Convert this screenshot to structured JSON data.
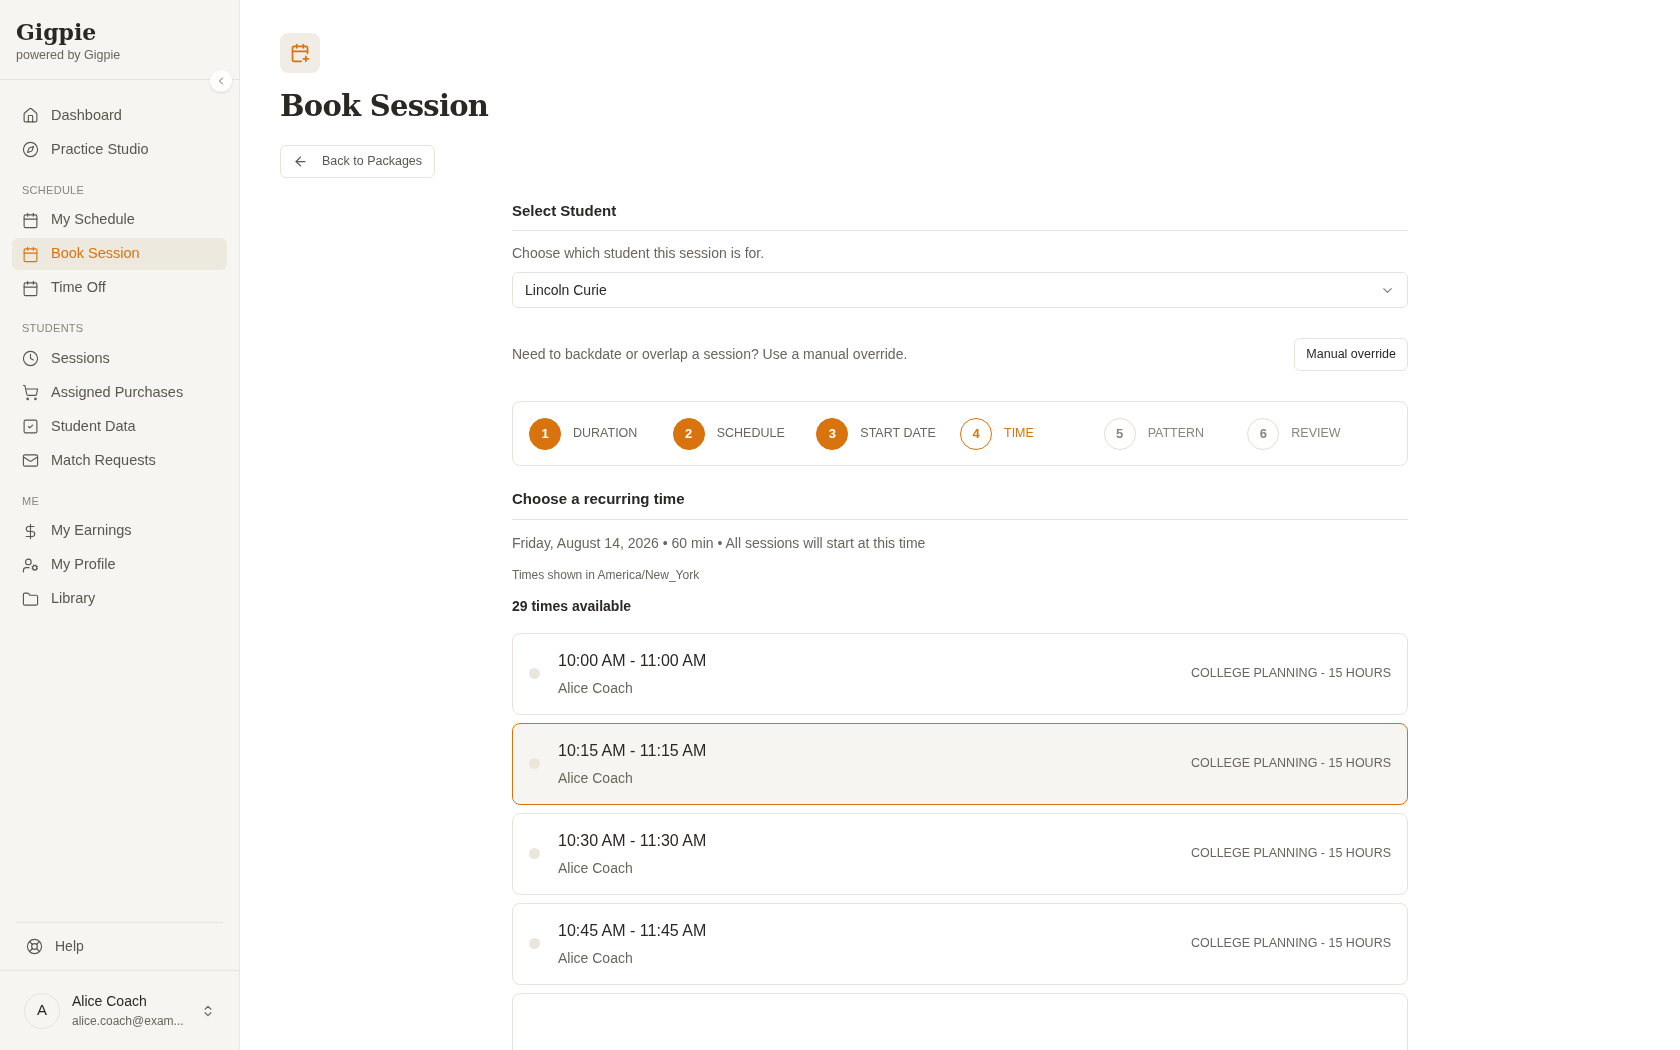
{
  "brand": {
    "name": "Gigpie",
    "tagline": "powered by Gigpie"
  },
  "sidebar": {
    "sections": [
      {
        "items": [
          {
            "label": "Dashboard",
            "selected": false
          },
          {
            "label": "Practice Studio",
            "selected": false
          }
        ]
      },
      {
        "heading": "SCHEDULE",
        "items": [
          {
            "label": "My Schedule",
            "selected": false
          },
          {
            "label": "Book Session",
            "selected": true
          },
          {
            "label": "Time Off",
            "selected": false
          }
        ]
      },
      {
        "heading": "STUDENTS",
        "items": [
          {
            "label": "Sessions",
            "selected": false
          },
          {
            "label": "Assigned Purchases",
            "selected": false
          },
          {
            "label": "Student Data",
            "selected": false
          },
          {
            "label": "Match Requests",
            "selected": false
          }
        ]
      },
      {
        "heading": "ME",
        "items": [
          {
            "label": "My Earnings",
            "selected": false
          },
          {
            "label": "My Profile",
            "selected": false
          },
          {
            "label": "Library",
            "selected": false
          }
        ]
      }
    ],
    "help": "Help",
    "user": {
      "initial": "A",
      "name": "Alice Coach",
      "email": "alice.coach@exam..."
    }
  },
  "page": {
    "title": "Book Session",
    "back_button": "Back to Packages"
  },
  "student": {
    "heading": "Select Student",
    "hint": "Choose which student this session is for.",
    "value": "Lincoln Curie",
    "override_text": "Need to backdate or overlap a session? Use a manual override.",
    "override_button": "Manual override"
  },
  "steps": [
    {
      "number": "1",
      "label": "DURATION",
      "completed": true,
      "selected": false
    },
    {
      "number": "2",
      "label": "SCHEDULE",
      "completed": true,
      "selected": false
    },
    {
      "number": "3",
      "label": "START DATE",
      "completed": true,
      "selected": false
    },
    {
      "number": "4",
      "label": "TIME",
      "completed": false,
      "selected": true
    },
    {
      "number": "5",
      "label": "PATTERN",
      "completed": false,
      "selected": false
    },
    {
      "number": "6",
      "label": "REVIEW",
      "completed": false,
      "selected": false
    }
  ],
  "time": {
    "heading": "Choose a recurring time",
    "summary": "Friday, August 14, 2026 • 60 min • All sessions will start at this time",
    "timezone": "Times shown in America/New_York",
    "count": "29 times available",
    "slots": [
      {
        "time": "10:00 AM - 11:00 AM",
        "coach": "Alice Coach",
        "package": "COLLEGE PLANNING - 15 HOURS",
        "selected": false
      },
      {
        "time": "10:15 AM - 11:15 AM",
        "coach": "Alice Coach",
        "package": "COLLEGE PLANNING - 15 HOURS",
        "selected": true
      },
      {
        "time": "10:30 AM - 11:30 AM",
        "coach": "Alice Coach",
        "package": "COLLEGE PLANNING - 15 HOURS",
        "selected": false
      },
      {
        "time": "10:45 AM - 11:45 AM",
        "coach": "Alice Coach",
        "package": "COLLEGE PLANNING - 15 HOURS",
        "selected": false
      }
    ]
  }
}
